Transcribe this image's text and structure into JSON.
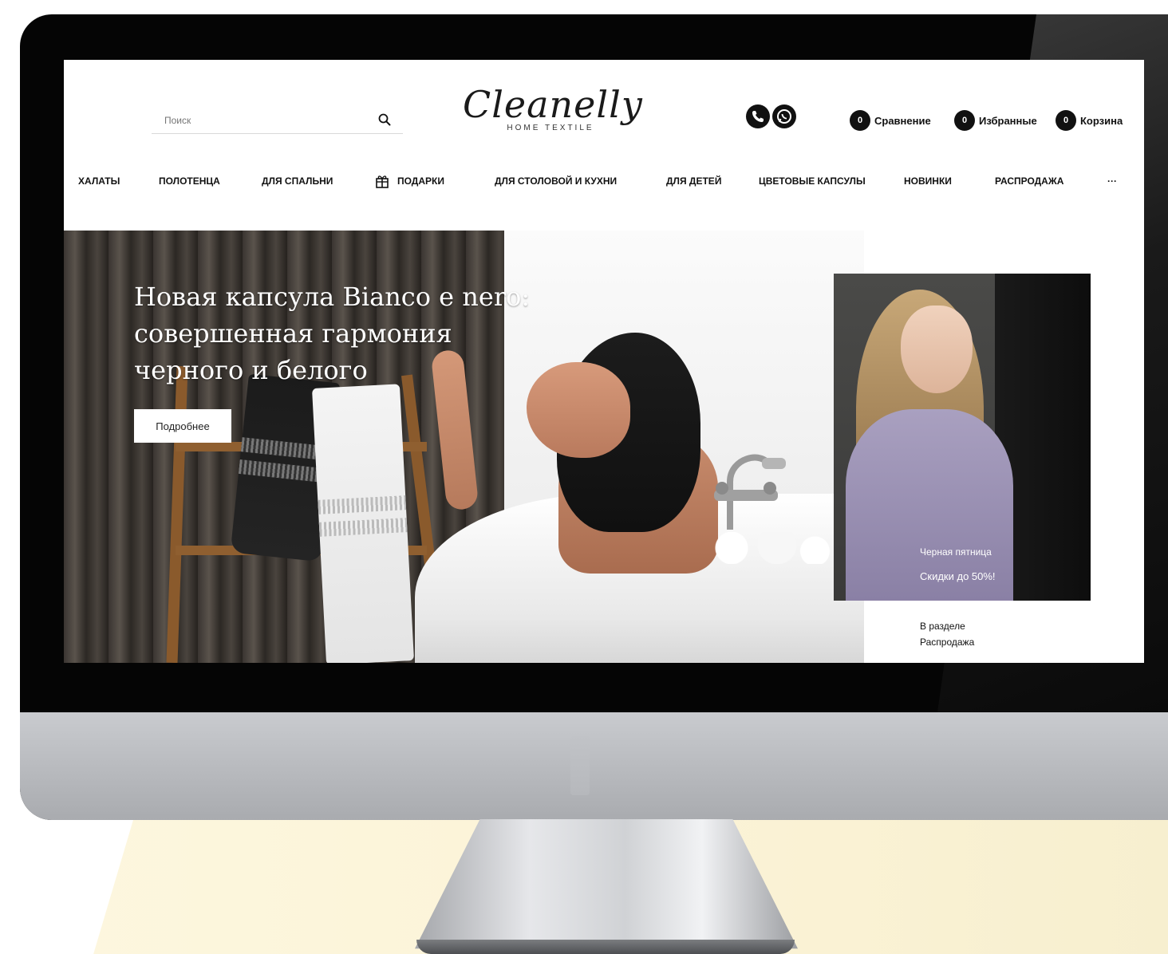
{
  "search": {
    "placeholder": "Поиск"
  },
  "brand": {
    "name": "Cleanelly",
    "subtitle": "HOME TEXTILE"
  },
  "contacts": {
    "icons": [
      "phone-icon",
      "whatsapp-icon"
    ]
  },
  "counters": [
    {
      "count": "0",
      "label": "Сравнение"
    },
    {
      "count": "0",
      "label": "Избранные"
    },
    {
      "count": "0",
      "label": "Корзина"
    }
  ],
  "nav": {
    "items": [
      "ХАЛАТЫ",
      "ПОЛОТЕНЦА",
      "ДЛЯ СПАЛЬНИ",
      "ПОДАРКИ",
      "ДЛЯ СТОЛОВОЙ И КУХНИ",
      "ДЛЯ ДЕТЕЙ",
      "ЦВЕТОВЫЕ КАПСУЛЫ",
      "НОВИНКИ",
      "РАСПРОДАЖА",
      "···"
    ]
  },
  "hero": {
    "title_line1": "Новая капсула Bianco e nero:",
    "title_line2": "совершенная гармония",
    "title_line3": "черного и белого",
    "button_label": "Подробнее"
  },
  "promo": {
    "line1": "Черная пятница",
    "line2": "Скидки до 50%!",
    "note_line1": "В разделе",
    "note_line2": "Распродажа"
  },
  "colors": {
    "accent": "#111111",
    "background": "#ffffff",
    "floor": "#fbf3d6"
  }
}
